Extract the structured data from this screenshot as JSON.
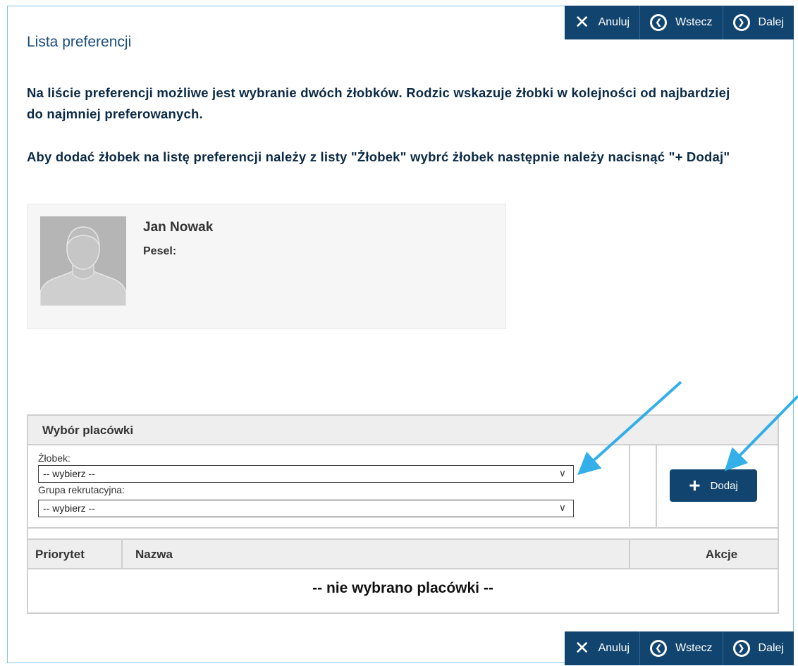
{
  "header": {
    "title": "Lista preferencji"
  },
  "nav": {
    "cancel_label": "Anuluj",
    "back_label": "Wstecz",
    "next_label": "Dalej"
  },
  "info": {
    "p1_a": "Na liście preferencji możliwe jest wybranie ",
    "p1_b": "dwóch żłobków",
    "p1_c": ". Rodzic wskazuje żłobki w kolejności od najbardziej do najmniej preferowanych.",
    "p2_a": "Aby dodać żłobek na listę preferencji należy z listy \"Żłobek\" wybrć żłobek następnie należy nacisnąć \"",
    "p2_b": "+ Dodaj",
    "p2_c": "\""
  },
  "child": {
    "name": "Jan Nowak",
    "pesel_label": "Pesel:"
  },
  "selection_panel": {
    "title": "Wybór placówki",
    "nursery_label": "Żłobek:",
    "nursery_value": "-- wybierz --",
    "group_label": "Grupa rekrutacyjna:",
    "group_value": "-- wybierz --",
    "add_label": "Dodaj"
  },
  "table": {
    "columns": [
      "Priorytet",
      "Nazwa",
      "Akcje"
    ],
    "empty_text": "-- nie wybrano placówki --"
  },
  "colors": {
    "primary": "#11456f",
    "frame_border": "#7fc6e8",
    "arrow": "#1ea7e8"
  },
  "icons": {
    "cancel": "x-icon",
    "back": "arrow-left-circle-icon",
    "next": "arrow-right-circle-icon",
    "add": "plus-icon",
    "dropdown": "chevron-down-icon"
  }
}
